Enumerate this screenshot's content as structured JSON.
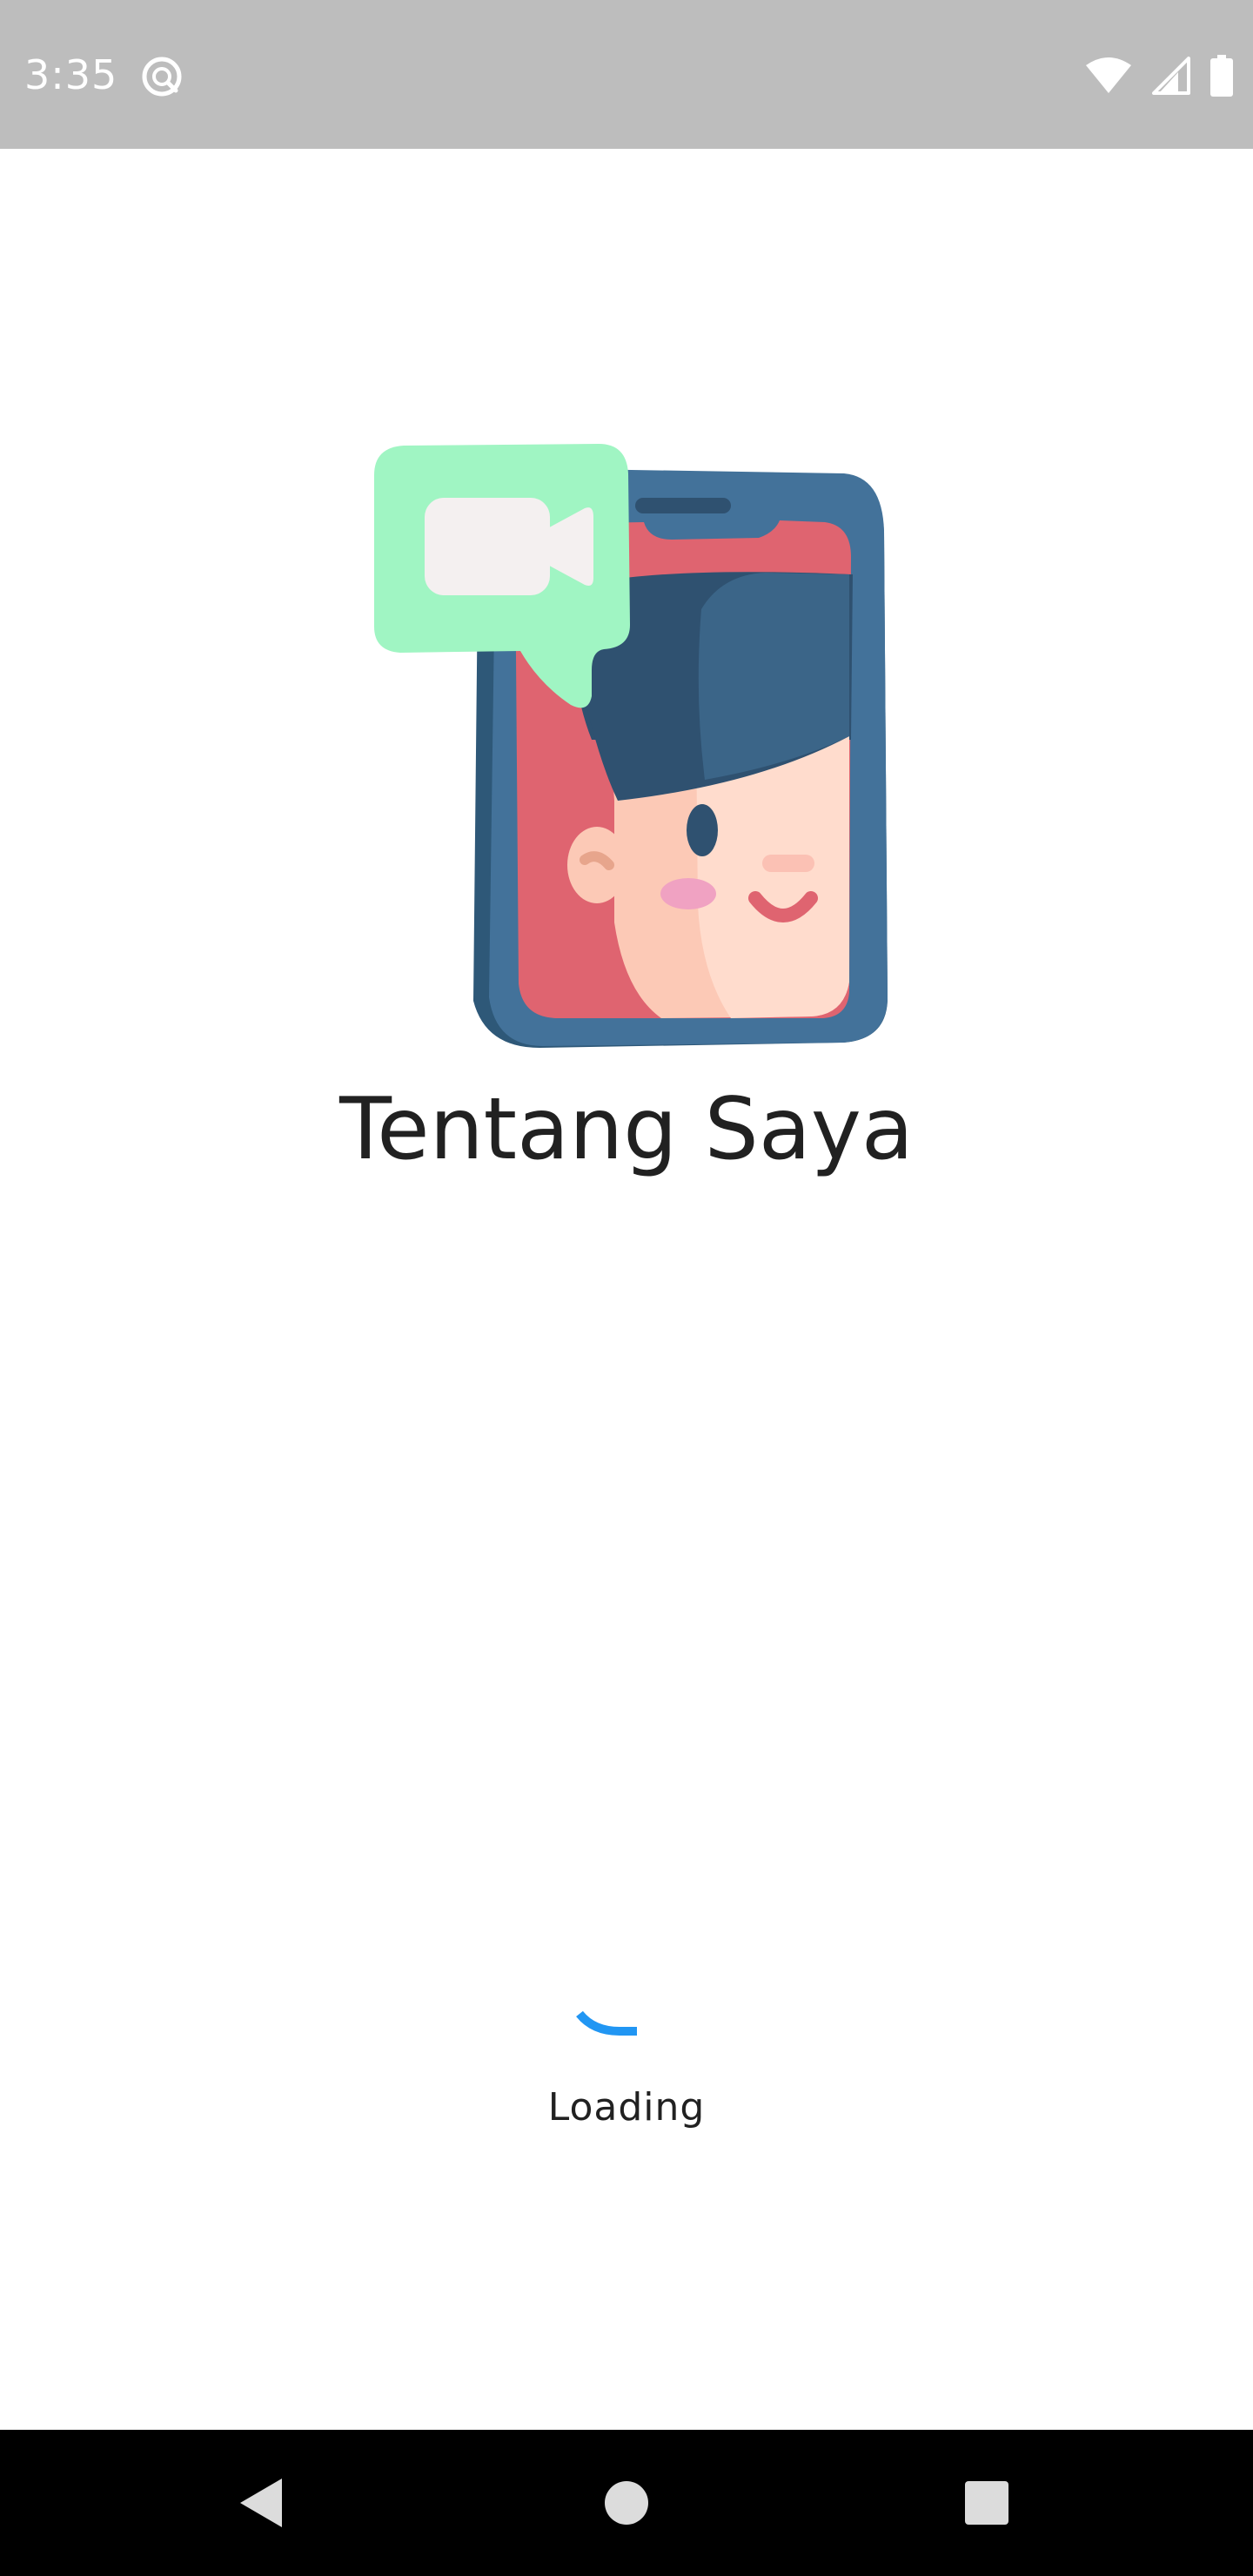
{
  "status_bar": {
    "time": "3:35",
    "icons": [
      "app-notification-icon",
      "wifi-icon",
      "cellular-signal-icon",
      "battery-icon"
    ]
  },
  "splash": {
    "title": "Tentang Saya",
    "loading_label": "Loading",
    "illustration": "video-call-phone-illustration",
    "spinner_color": "#2196f3"
  },
  "nav_bar": {
    "back": "back-icon",
    "home": "home-icon",
    "recents": "recents-icon"
  },
  "colors": {
    "status_bar_bg": "#bdbdbd",
    "nav_bar_bg": "#000000",
    "phone_frame": "#3f6f96",
    "screen_red": "#df6470",
    "bubble_green": "#a0f5c3",
    "hair": "#2f5170",
    "skin": "#ffd3c4"
  }
}
